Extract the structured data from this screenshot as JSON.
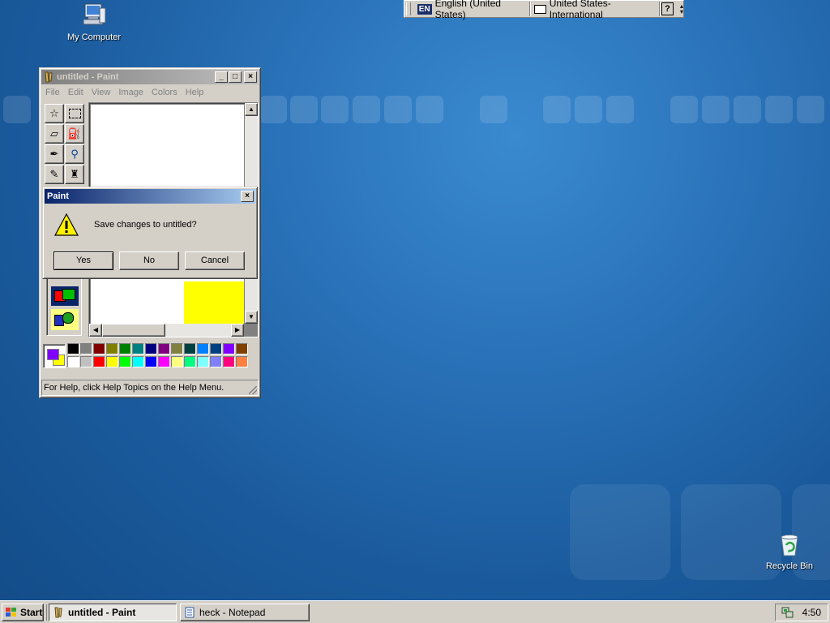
{
  "desktop": {
    "icons": [
      {
        "label": "My Computer"
      },
      {
        "label": "Recycle Bin"
      }
    ]
  },
  "langbar": {
    "language_code": "EN",
    "language": "English (United States)",
    "keyboard": "United States-International",
    "help": "?"
  },
  "paint_window": {
    "title": "untitled - Paint",
    "menu": [
      "File",
      "Edit",
      "View",
      "Image",
      "Colors",
      "Help"
    ],
    "status": "For Help, click Help Topics on the Help Menu.",
    "fg_color": "#8000ff",
    "bg_color": "#ffff00",
    "palette_top": [
      "#000000",
      "#808080",
      "#800000",
      "#808000",
      "#008000",
      "#008080",
      "#000080",
      "#800080",
      "#808040",
      "#004040",
      "#0080ff",
      "#004080",
      "#8000ff",
      "#804000"
    ],
    "palette_bottom": [
      "#ffffff",
      "#c0c0c0",
      "#ff0000",
      "#ffff00",
      "#00ff00",
      "#00ffff",
      "#0000ff",
      "#ff00ff",
      "#ffff80",
      "#00ff80",
      "#80ffff",
      "#8080ff",
      "#ff0080",
      "#ff8040"
    ]
  },
  "dialog": {
    "title": "Paint",
    "message": "Save changes to untitled?",
    "yes": "Yes",
    "no": "No",
    "cancel": "Cancel"
  },
  "taskbar": {
    "start": "Start",
    "tasks": [
      "untitled - Paint",
      "heck - Notepad"
    ],
    "clock": "4:50"
  }
}
